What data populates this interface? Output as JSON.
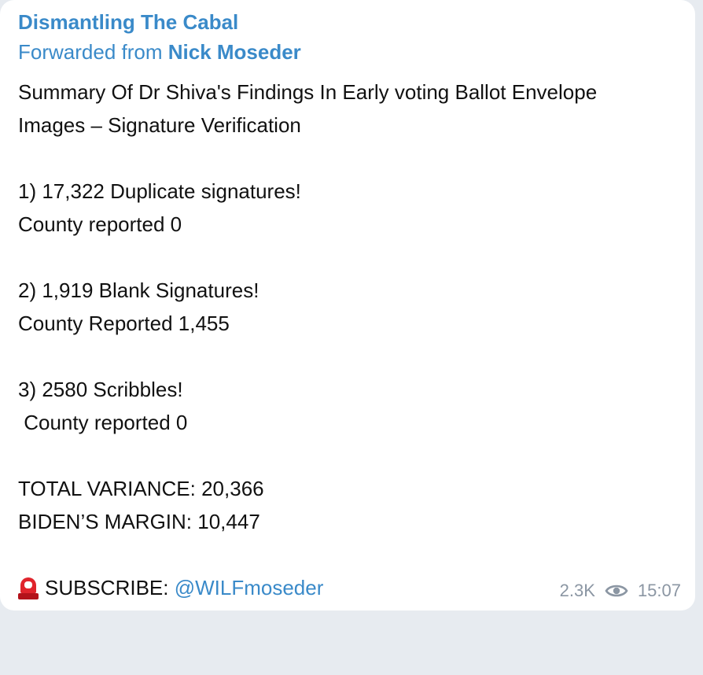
{
  "message": {
    "channel_name": "Dismantling The Cabal",
    "forwarded_prefix": "Forwarded from ",
    "forwarded_from": "Nick Moseder",
    "lines": [
      "Summary Of Dr Shiva's Findings In Early voting Ballot Envelope",
      "Images – Signature Verification",
      "",
      "1) 17,322 Duplicate signatures!",
      "County reported 0",
      "",
      "2) 1,919 Blank Signatures!",
      "County Reported 1,455",
      "",
      "3) 2580 Scribbles!",
      " County reported 0",
      "",
      "TOTAL VARIANCE: 20,366",
      "BIDEN’S MARGIN: 10,447",
      ""
    ],
    "subscribe_label": "SUBSCRIBE: ",
    "subscribe_handle": "@WILFmoseder",
    "subscribe_icon": "siren-icon",
    "views": "2.3K",
    "views_icon": "eye-icon",
    "time": "15:07"
  },
  "colors": {
    "link": "#3a8ac9",
    "text": "#111111",
    "meta": "#8b96a3",
    "background": "#e7ebf0",
    "bubble": "#ffffff"
  }
}
